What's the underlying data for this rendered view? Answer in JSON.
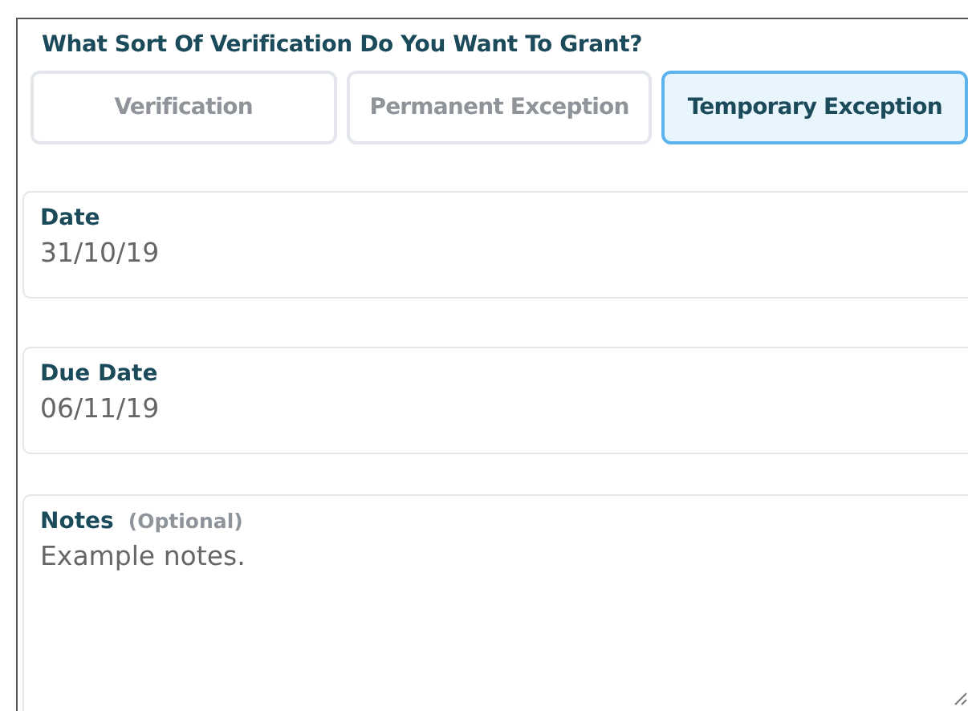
{
  "question": "What Sort Of Verification Do You Want To Grant?",
  "options": [
    {
      "label": "Verification",
      "selected": false
    },
    {
      "label": "Permanent Exception",
      "selected": false
    },
    {
      "label": "Temporary Exception",
      "selected": true
    }
  ],
  "fields": [
    {
      "kind": "input",
      "label": "Date",
      "value": "31/10/19"
    },
    {
      "kind": "input",
      "label": "Due Date",
      "value": "06/11/19"
    },
    {
      "kind": "textarea",
      "label": "Notes",
      "hint": "(Optional)",
      "value": "Example notes."
    }
  ]
}
